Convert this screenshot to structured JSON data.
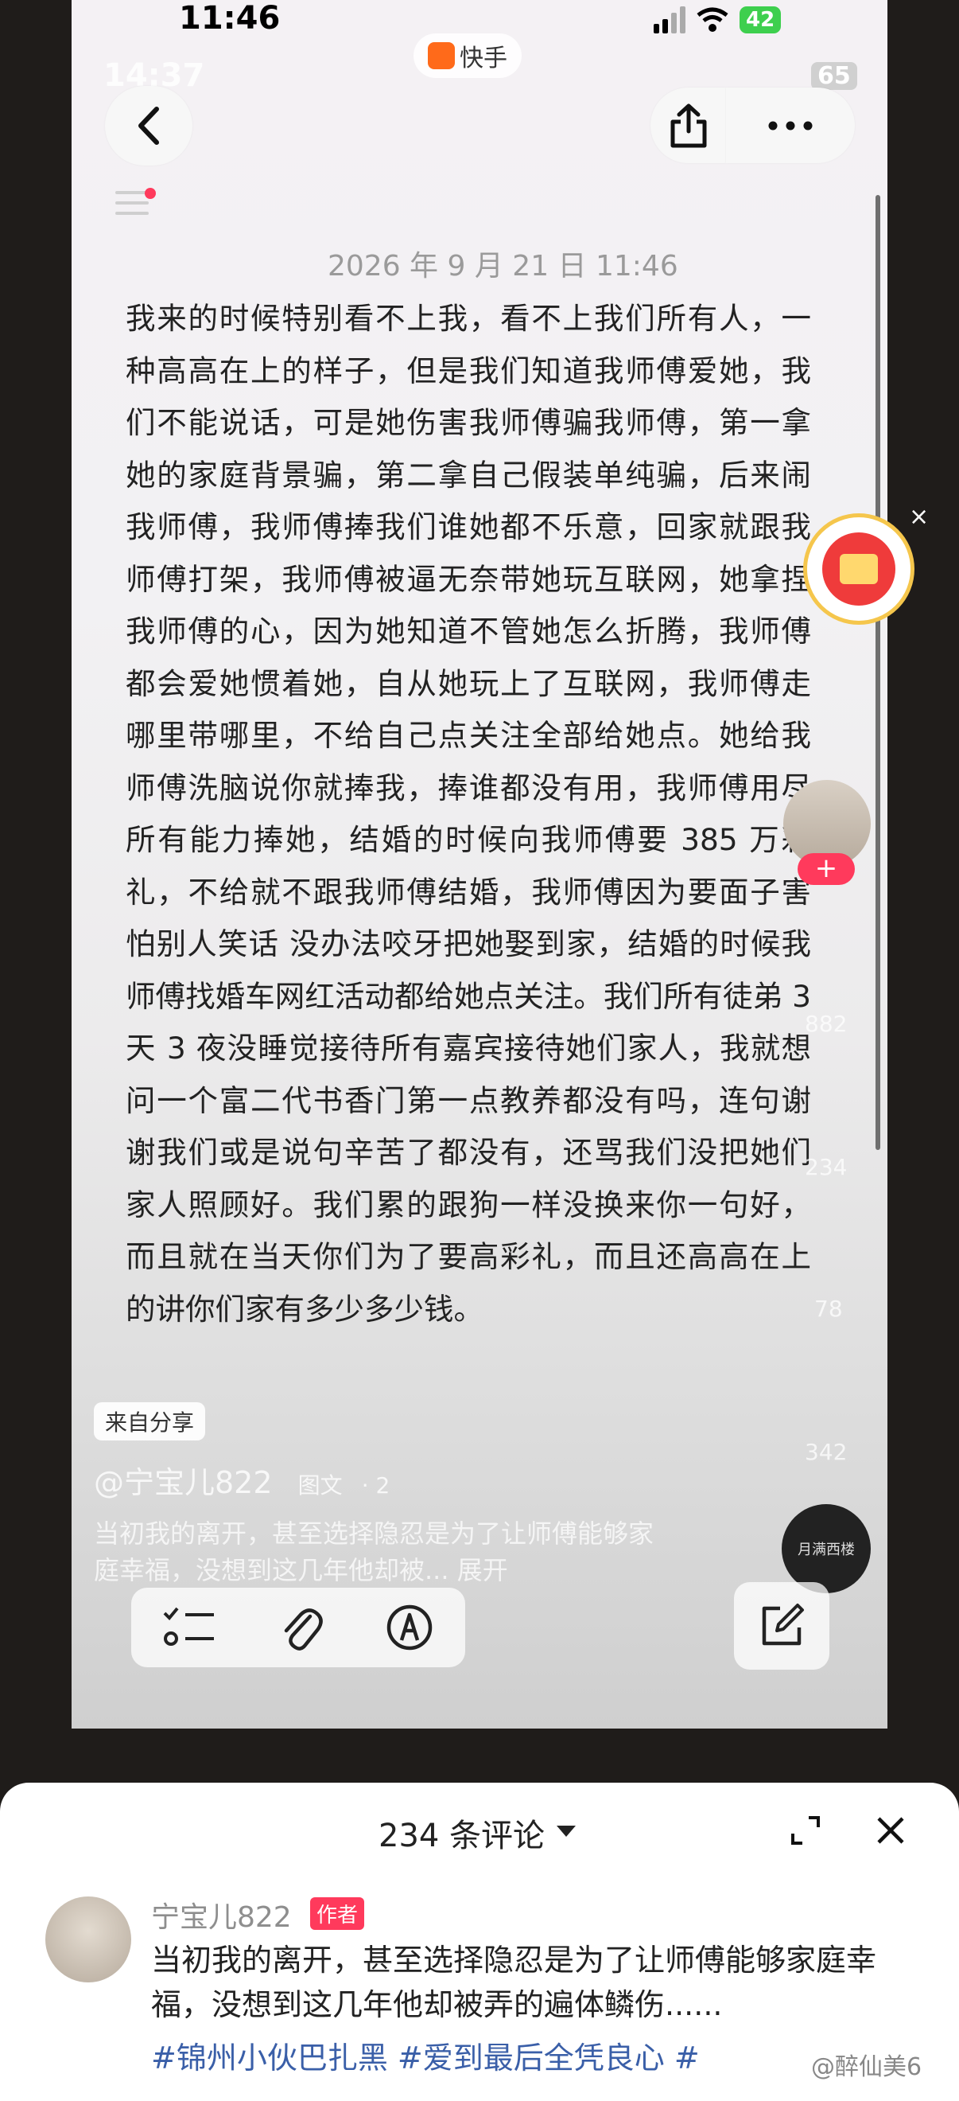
{
  "status_bar": {
    "time": "11:46",
    "battery": "42"
  },
  "ghost_status": {
    "time": "14:37",
    "battery": "65"
  },
  "app": {
    "name": "快手"
  },
  "note": {
    "date": "2026 年 9 月 21 日 11:46",
    "body": "我来的时候特别看不上我，看不上我们所有人，一种高高在上的样子，但是我们知道我师傅爱她，我们不能说话，可是她伤害我师傅骗我师傅，第一拿她的家庭背景骗，第二拿自己假装单纯骗，后来闹我师傅，我师傅捧我们谁她都不乐意，回家就跟我师傅打架，我师傅被逼无奈带她玩互联网，她拿捏我师傅的心，因为她知道不管她怎么折腾，我师傅都会爱她惯着她，自从她玩上了互联网，我师傅走哪里带哪里，不给自己点关注全部给她点。她给我师傅洗脑说你就捧我，捧谁都没有用，我师傅用尽所有能力捧她，结婚的时候向我师傅要 385 万彩礼，不给就不跟我师傅结婚，我师傅因为要面子害怕别人笑话 没办法咬牙把她娶到家，结婚的时候我师傅找婚车网红活动都给她点关注。我们所有徒弟 3 天 3 夜没睡觉接待所有嘉宾接待她们家人，我就想问一个富二代书香门第一点教养都没有吗，连句谢谢我们或是说句辛苦了都没有，还骂我们没把她们家人照顾好。我们累的跟狗一样没换来你一句好，而且就在当天你们为了要高彩礼，而且还高高在上的讲你们家有多少多少钱。"
  },
  "side": {
    "likes": "882",
    "comments": "234",
    "stars": "78",
    "shares": "342"
  },
  "overlay": {
    "source": "来自分享",
    "author": "@宁宝儿822",
    "type": "图文",
    "count": "· 2",
    "desc": "当初我的离开，甚至选择隐忍是为了让师傅能够家庭幸福，没想到这几年他却被... 展开",
    "music": "月满西楼"
  },
  "comments": {
    "header": "234 条评论",
    "items": [
      {
        "name": "宁宝儿822",
        "tag": "作者",
        "text": "当初我的离开，甚至选择隐忍是为了让师傅能够家庭幸福，没想到这几年他却被弄的遍体鳞伤......",
        "tags": "#锦州小伙巴扎黑 #爱到最后全凭良心 #"
      }
    ]
  },
  "watermark": "@醉仙美6"
}
